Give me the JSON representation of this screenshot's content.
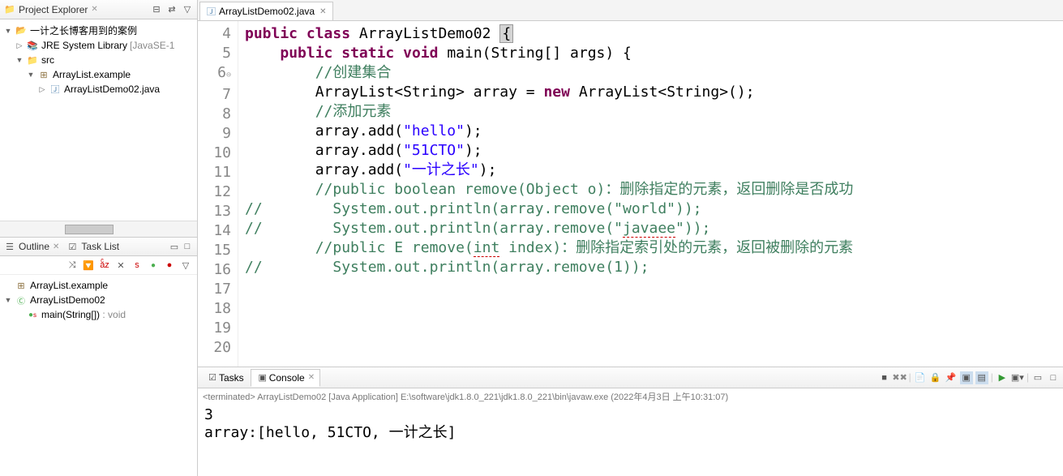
{
  "project_explorer": {
    "title": "Project Explorer",
    "root": "一计之长博客用到的案例",
    "jre": "JRE System Library",
    "jre_suffix": "[JavaSE-1",
    "src": "src",
    "package": "ArrayList.example",
    "file": "ArrayListDemo02.java"
  },
  "outline": {
    "title": "Outline",
    "task_list": "Task List",
    "package": "ArrayList.example",
    "class": "ArrayListDemo02",
    "method": "main(String[]) : void",
    "method_ret": ": void"
  },
  "editor": {
    "tab": "ArrayListDemo02.java",
    "lines": {
      "l4": "",
      "l5_public": "public",
      "l5_class": "class",
      "l5_name": "ArrayListDemo02",
      "l5_brace": "{",
      "l6_public": "public",
      "l6_static": "static",
      "l6_void": "void",
      "l6_main": "main(String[] args) {",
      "l7_cmt": "//创建集合",
      "l8_a": "ArrayList<String> array = ",
      "l8_new": "new",
      "l8_b": " ArrayList<String>();",
      "l10_cmt": "//添加元素",
      "l11_a": "array.add(",
      "l11_s": "\"hello\"",
      "l11_b": ");",
      "l12_a": "array.add(",
      "l12_s": "\"51CTO\"",
      "l12_b": ");",
      "l13_a": "array.add(",
      "l13_s": "\"一计之长\"",
      "l13_b": ");",
      "l15_a": "//public boolean remove(Object o)",
      "l15_b": "：删除指定的元素，返回删除是否成功",
      "l16": "//        System.out.println(array.remove(\"world\"));",
      "l17_a": "//        System.out.println(array.remove(\"",
      "l17_b": "javaee",
      "l17_c": "\"));",
      "l19_a": "//public E remove(",
      "l19_b": "int",
      "l19_c": " index)",
      "l19_d": "：删除指定索引处的元素，返回被删除的元素",
      "l20": "//        System.out.println(array.remove(1));"
    },
    "line_numbers": [
      "4",
      "5",
      "6",
      "7",
      "8",
      "9",
      "10",
      "11",
      "12",
      "13",
      "14",
      "15",
      "16",
      "17",
      "18",
      "19",
      "20"
    ]
  },
  "console": {
    "tasks_tab": "Tasks",
    "console_tab": "Console",
    "terminated": "<terminated> ArrayListDemo02 [Java Application] E:\\software\\jdk1.8.0_221\\jdk1.8.0_221\\bin\\javaw.exe (2022年4月3日 上午10:31:07)",
    "out1": "3",
    "out2": "array:[hello, 51CTO, 一计之长]"
  }
}
